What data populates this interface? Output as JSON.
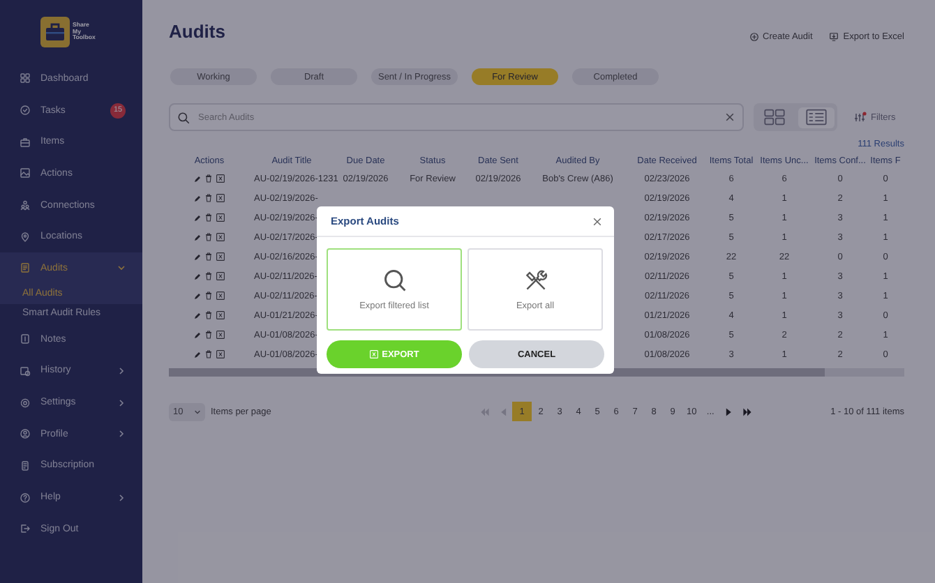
{
  "sidebar": {
    "logo_text": "Share My Toolbox",
    "items": [
      {
        "label": "Dashboard",
        "selected": false
      },
      {
        "label": "Tasks",
        "selected": false,
        "badge": "15"
      },
      {
        "label": "Items",
        "selected": false
      },
      {
        "label": "Actions",
        "selected": false
      },
      {
        "label": "Connections",
        "selected": false
      },
      {
        "label": "Locations",
        "selected": false
      },
      {
        "label": "Audits",
        "selected": true,
        "expanded": true,
        "children": [
          {
            "label": "All Audits",
            "selected": true
          },
          {
            "label": "Smart Audit Rules",
            "selected": false
          }
        ]
      },
      {
        "label": "Notes",
        "selected": false
      },
      {
        "label": "History",
        "selected": false,
        "expanded": false
      },
      {
        "label": "Settings",
        "selected": false,
        "expanded": false
      },
      {
        "label": "Profile",
        "selected": false,
        "expanded": false
      },
      {
        "label": "Subscription",
        "selected": false
      },
      {
        "label": "Help",
        "selected": false,
        "expanded": false
      },
      {
        "label": "Sign Out",
        "selected": false
      }
    ]
  },
  "header": {
    "title": "Audits",
    "actions": [
      {
        "label": "Create Audit"
      },
      {
        "label": "Export to Excel"
      }
    ]
  },
  "status_tabs": [
    {
      "label": "Working",
      "selected": false
    },
    {
      "label": "Draft",
      "selected": false
    },
    {
      "label": "Sent / In Progress",
      "selected": false
    },
    {
      "label": "For Review",
      "selected": true
    },
    {
      "label": "Completed",
      "selected": false
    }
  ],
  "search": {
    "placeholder": "Search Audits"
  },
  "view_toggle": [
    {
      "selected": false
    },
    {
      "selected": true
    }
  ],
  "filters": {
    "label": "Filters",
    "active": true
  },
  "results": "111 Results",
  "table": {
    "columns": [
      "Actions",
      "Audit Title",
      "Due Date",
      "Status",
      "Date Sent",
      "Audited By",
      "Date Received",
      "Items Total",
      "Items Unc...",
      "Items Conf...",
      "Items F"
    ],
    "rows": [
      {
        "title": "AU-02/19/2026-1231",
        "due_date": "02/19/2026",
        "status": "For Review",
        "date_sent": "02/19/2026",
        "audited_by": "Bob's Crew (A86)",
        "date_received": "02/23/2026",
        "items_total": "6",
        "items_unc": "6",
        "items_conf": "0",
        "items_f": "0"
      },
      {
        "title": "AU-02/19/2026-",
        "date_received": "02/19/2026",
        "items_total": "4",
        "items_unc": "1",
        "items_conf": "2",
        "items_f": "1"
      },
      {
        "title": "AU-02/19/2026-",
        "date_received": "02/19/2026",
        "items_total": "5",
        "items_unc": "1",
        "items_conf": "3",
        "items_f": "1"
      },
      {
        "title": "AU-02/17/2026-",
        "date_received": "02/17/2026",
        "items_total": "5",
        "items_unc": "1",
        "items_conf": "3",
        "items_f": "1"
      },
      {
        "title": "AU-02/16/2026-",
        "date_received": "02/19/2026",
        "items_total": "22",
        "items_unc": "22",
        "items_conf": "0",
        "items_f": "0"
      },
      {
        "title": "AU-02/11/2026-",
        "date_received": "02/11/2026",
        "items_total": "5",
        "items_unc": "1",
        "items_conf": "3",
        "items_f": "1"
      },
      {
        "title": "AU-02/11/2026-",
        "date_received": "02/11/2026",
        "items_total": "5",
        "items_unc": "1",
        "items_conf": "3",
        "items_f": "1"
      },
      {
        "title": "AU-01/21/2026-",
        "date_received": "01/21/2026",
        "items_total": "4",
        "items_unc": "1",
        "items_conf": "3",
        "items_f": "0"
      },
      {
        "title": "AU-01/08/2026-",
        "date_received": "01/08/2026",
        "items_total": "5",
        "items_unc": "2",
        "items_conf": "2",
        "items_f": "1"
      },
      {
        "title": "AU-01/08/2026-",
        "date_received": "01/08/2026",
        "items_total": "3",
        "items_unc": "1",
        "items_conf": "2",
        "items_f": "0"
      }
    ]
  },
  "pagination": {
    "per_page": "10",
    "per_page_label": "Items per page",
    "nav": [
      {
        "kind": "first",
        "disabled": true
      },
      {
        "kind": "prev",
        "disabled": true
      },
      {
        "kind": "next",
        "disabled": false
      },
      {
        "kind": "last",
        "disabled": false
      }
    ],
    "pages": [
      {
        "label": "1",
        "selected": true
      },
      {
        "label": "2",
        "selected": false
      },
      {
        "label": "3",
        "selected": false
      },
      {
        "label": "4",
        "selected": false
      },
      {
        "label": "5",
        "selected": false
      },
      {
        "label": "6",
        "selected": false
      },
      {
        "label": "7",
        "selected": false
      },
      {
        "label": "8",
        "selected": false
      },
      {
        "label": "9",
        "selected": false
      },
      {
        "label": "10",
        "selected": false
      }
    ],
    "ellipsis": "...",
    "summary": "1 - 10 of 111 items"
  },
  "modal": {
    "title": "Export Audits",
    "options": [
      {
        "label": "Export filtered list",
        "selected": true
      },
      {
        "label": "Export all",
        "selected": false
      }
    ],
    "buttons": [
      {
        "label": "EXPORT",
        "kind": "primary"
      },
      {
        "label": "CANCEL",
        "kind": "secondary"
      }
    ]
  }
}
